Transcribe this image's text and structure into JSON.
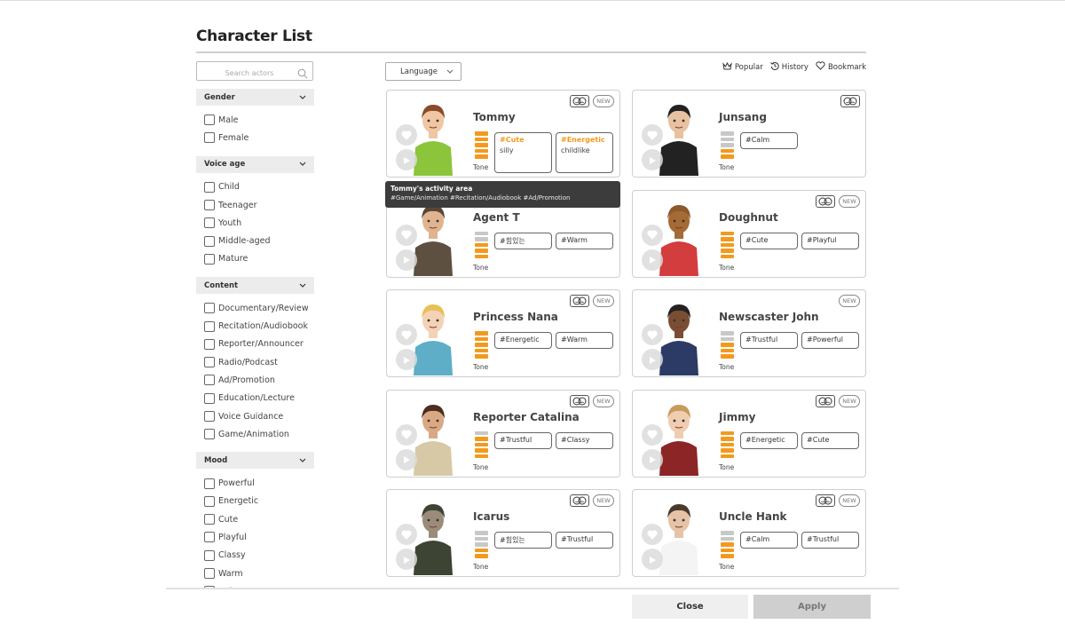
{
  "title": "Character List",
  "search": {
    "placeholder": "Search actors"
  },
  "filters": [
    {
      "name": "Gender",
      "options": [
        "Male",
        "Female"
      ]
    },
    {
      "name": "Voice age",
      "options": [
        "Child",
        "Teenager",
        "Youth",
        "Middle-aged",
        "Mature"
      ]
    },
    {
      "name": "Content",
      "options": [
        "Documentary/Review",
        "Recitation/Audiobook",
        "Reporter/Announcer",
        "Radio/Podcast",
        "Ad/Promotion",
        "Education/Lecture",
        "Voice Guidance",
        "Game/Animation"
      ]
    },
    {
      "name": "Mood",
      "options": [
        "Powerful",
        "Energetic",
        "Cute",
        "Playful",
        "Classy",
        "Warm",
        "Calm"
      ]
    }
  ],
  "toolbar": {
    "language": "Language",
    "popular": "Popular",
    "history": "History",
    "bookmark": "Bookmark"
  },
  "badge_new": "NEW",
  "tone_label": "Tone",
  "accent_color": "#f29a1e",
  "characters": [
    {
      "name": "Tommy",
      "tone_level": 5,
      "emote": true,
      "new": true,
      "tags": [
        {
          "tag": "#Cute",
          "desc": "silly"
        },
        {
          "tag": "#Energetic",
          "desc": "childlike"
        }
      ]
    },
    {
      "name": "Junsang",
      "tone_level": 2,
      "emote": true,
      "new": false,
      "tags": [
        {
          "tag": "#Calm"
        }
      ]
    },
    {
      "name": "Agent T",
      "tone_level": 3,
      "emote": false,
      "new": false,
      "tags": [
        {
          "tag": "#힘있는"
        },
        {
          "tag": "#Warm"
        }
      ]
    },
    {
      "name": "Doughnut",
      "tone_level": 5,
      "emote": true,
      "new": true,
      "tags": [
        {
          "tag": "#Cute"
        },
        {
          "tag": "#Playful"
        }
      ]
    },
    {
      "name": "Princess Nana",
      "tone_level": 5,
      "emote": true,
      "new": true,
      "tags": [
        {
          "tag": "#Energetic"
        },
        {
          "tag": "#Warm"
        }
      ]
    },
    {
      "name": "Newscaster John",
      "tone_level": 3,
      "emote": false,
      "new": true,
      "tags": [
        {
          "tag": "#Trustful"
        },
        {
          "tag": "#Powerful"
        }
      ]
    },
    {
      "name": "Reporter Catalina",
      "tone_level": 4,
      "emote": true,
      "new": true,
      "tags": [
        {
          "tag": "#Trustful"
        },
        {
          "tag": "#Classy"
        }
      ]
    },
    {
      "name": "Jimmy",
      "tone_level": 5,
      "emote": true,
      "new": true,
      "tags": [
        {
          "tag": "#Energetic"
        },
        {
          "tag": "#Cute"
        }
      ]
    },
    {
      "name": "Icarus",
      "tone_level": 2,
      "emote": true,
      "new": true,
      "tags": [
        {
          "tag": "#힘있는"
        },
        {
          "tag": "#Trustful"
        }
      ]
    },
    {
      "name": "Uncle Hank",
      "tone_level": 3,
      "emote": true,
      "new": true,
      "tags": [
        {
          "tag": "#Calm"
        },
        {
          "tag": "#Trustful"
        }
      ]
    }
  ],
  "tooltip": {
    "title": "Tommy's activity area",
    "body": "#Game/Animation #Recitation/Audiobook #Ad/Promotion"
  },
  "buttons": {
    "close": "Close",
    "apply": "Apply"
  }
}
